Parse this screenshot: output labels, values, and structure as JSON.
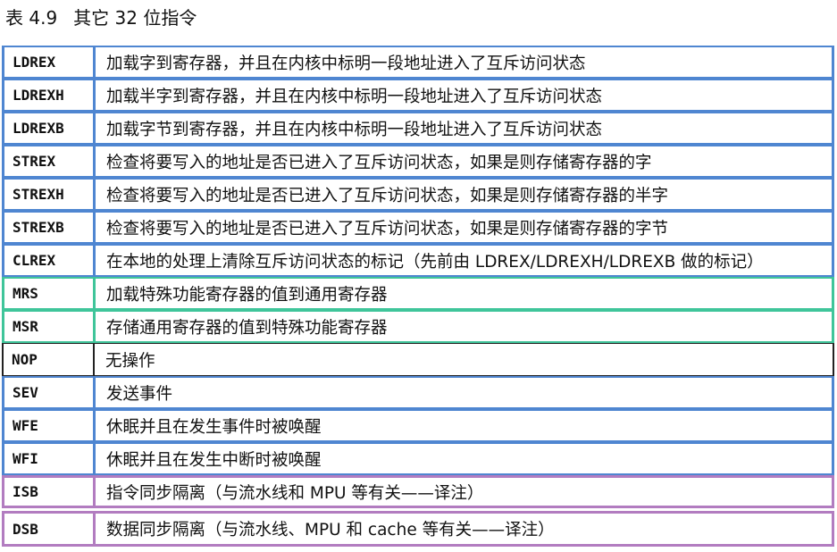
{
  "caption": {
    "number": "表 4.9",
    "title": "其它 32 位指令"
  },
  "rows": [
    {
      "cmd": "LDREX",
      "desc": "加载字到寄存器，并且在内核中标明一段地址进入了互斥访问状态",
      "group": "blue"
    },
    {
      "cmd": "LDREXH",
      "desc": "加载半字到寄存器，并且在内核中标明一段地址进入了互斥访问状态",
      "group": "blue"
    },
    {
      "cmd": "LDREXB",
      "desc": "加载字节到寄存器，并且在内核中标明一段地址进入了互斥访问状态",
      "group": "blue"
    },
    {
      "cmd": "STREX",
      "desc": "检查将要写入的地址是否已进入了互斥访问状态，如果是则存储寄存器的字",
      "group": "blue"
    },
    {
      "cmd": "STREXH",
      "desc": "检查将要写入的地址是否已进入了互斥访问状态，如果是则存储寄存器的半字",
      "group": "blue"
    },
    {
      "cmd": "STREXB",
      "desc": "检查将要写入的地址是否已进入了互斥访问状态，如果是则存储寄存器的字节",
      "group": "blue"
    },
    {
      "cmd": "CLREX",
      "desc": "在本地的处理上清除互斥访问状态的标记（先前由 LDREX/LDREXH/LDREXB 做的标记）",
      "group": "blue"
    },
    {
      "cmd": "MRS",
      "desc": "加载特殊功能寄存器的值到通用寄存器",
      "group": "green"
    },
    {
      "cmd": "MSR",
      "desc": "存储通用寄存器的值到特殊功能寄存器",
      "group": "green"
    },
    {
      "cmd": "NOP",
      "desc": "无操作",
      "group": "black"
    },
    {
      "cmd": "SEV",
      "desc": "发送事件",
      "group": "blue"
    },
    {
      "cmd": "WFE",
      "desc": "休眠并且在发生事件时被唤醒",
      "group": "blue"
    },
    {
      "cmd": "WFI",
      "desc": "休眠并且在发生中断时被唤醒",
      "group": "blue"
    },
    {
      "cmd": "ISB",
      "desc": "指令同步隔离（与流水线和 MPU 等有关——译注）",
      "group": "purple"
    },
    {
      "cmd": "DSB",
      "desc": "数据同步隔离（与流水线、MPU 和 cache 等有关——译注）",
      "group": "purple"
    }
  ]
}
